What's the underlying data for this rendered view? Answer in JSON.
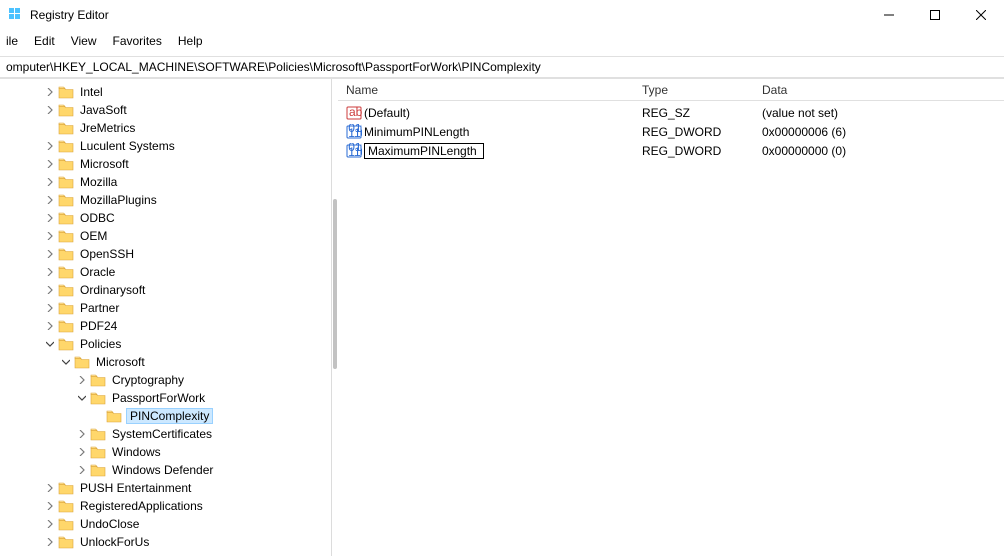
{
  "window": {
    "title": "Registry Editor"
  },
  "menu": {
    "file": "ile",
    "edit": "Edit",
    "view": "View",
    "favorites": "Favorites",
    "help": "Help"
  },
  "address": "omputer\\HKEY_LOCAL_MACHINE\\SOFTWARE\\Policies\\Microsoft\\PassportForWork\\PINComplexity",
  "columns": {
    "name": "Name",
    "type": "Type",
    "data": "Data"
  },
  "values": [
    {
      "icon": "sz",
      "name": "(Default)",
      "type": "REG_SZ",
      "data": "(value not set)",
      "editing": false
    },
    {
      "icon": "bin",
      "name": "MinimumPINLength",
      "type": "REG_DWORD",
      "data": "0x00000006 (6)",
      "editing": false
    },
    {
      "icon": "bin",
      "name": "MaximumPINLength",
      "type": "REG_DWORD",
      "data": "0x00000000 (0)",
      "editing": true
    }
  ],
  "tree": {
    "baseIndent": 44,
    "nodes": [
      {
        "label": "Intel",
        "depth": 0,
        "chev": "right"
      },
      {
        "label": "JavaSoft",
        "depth": 0,
        "chev": "right"
      },
      {
        "label": "JreMetrics",
        "depth": 0,
        "chev": "none"
      },
      {
        "label": "Luculent Systems",
        "depth": 0,
        "chev": "right"
      },
      {
        "label": "Microsoft",
        "depth": 0,
        "chev": "right"
      },
      {
        "label": "Mozilla",
        "depth": 0,
        "chev": "right"
      },
      {
        "label": "MozillaPlugins",
        "depth": 0,
        "chev": "right"
      },
      {
        "label": "ODBC",
        "depth": 0,
        "chev": "right"
      },
      {
        "label": "OEM",
        "depth": 0,
        "chev": "right"
      },
      {
        "label": "OpenSSH",
        "depth": 0,
        "chev": "right"
      },
      {
        "label": "Oracle",
        "depth": 0,
        "chev": "right"
      },
      {
        "label": "Ordinarysoft",
        "depth": 0,
        "chev": "right"
      },
      {
        "label": "Partner",
        "depth": 0,
        "chev": "right"
      },
      {
        "label": "PDF24",
        "depth": 0,
        "chev": "right"
      },
      {
        "label": "Policies",
        "depth": 0,
        "chev": "down"
      },
      {
        "label": "Microsoft",
        "depth": 1,
        "chev": "down"
      },
      {
        "label": "Cryptography",
        "depth": 2,
        "chev": "right"
      },
      {
        "label": "PassportForWork",
        "depth": 2,
        "chev": "down"
      },
      {
        "label": "PINComplexity",
        "depth": 3,
        "chev": "none",
        "selected": true
      },
      {
        "label": "SystemCertificates",
        "depth": 2,
        "chev": "right"
      },
      {
        "label": "Windows",
        "depth": 2,
        "chev": "right"
      },
      {
        "label": "Windows Defender",
        "depth": 2,
        "chev": "right"
      },
      {
        "label": "PUSH Entertainment",
        "depth": 0,
        "chev": "right"
      },
      {
        "label": "RegisteredApplications",
        "depth": 0,
        "chev": "right"
      },
      {
        "label": "UndoClose",
        "depth": 0,
        "chev": "right"
      },
      {
        "label": "UnlockForUs",
        "depth": 0,
        "chev": "right"
      }
    ]
  }
}
